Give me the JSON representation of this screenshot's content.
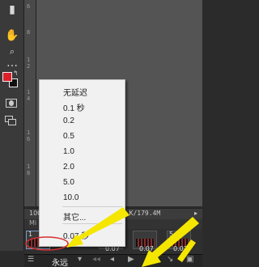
{
  "toolbar": {
    "tools": [
      {
        "icon": "hand-icon",
        "glyph": "✋"
      },
      {
        "icon": "zoom-icon",
        "glyph": "🔍"
      },
      {
        "icon": "ellipsis-icon",
        "glyph": "…"
      }
    ],
    "foreground_color": "#e01e2a",
    "background_color": "#111111"
  },
  "ruler": {
    "numbers": [
      "6",
      "8",
      "1",
      "2",
      "1",
      "4",
      "1",
      "6",
      "1",
      "8"
    ]
  },
  "statusbar": {
    "left": "100",
    "doc_size": "0 K/179.4M"
  },
  "panel": {
    "tab_label": "Mi"
  },
  "timeline": {
    "frames": [
      {
        "number": "1",
        "delay": ""
      },
      {
        "number": "4",
        "delay": "0.07"
      },
      {
        "number": "",
        "delay": "0.07"
      },
      {
        "number": "5",
        "delay": "0.07"
      }
    ],
    "loop_label": "永远"
  },
  "delay_menu": {
    "items": [
      "无延迟",
      "0.1 秒",
      "0.2",
      "0.5",
      "1.0",
      "2.0",
      "5.0",
      "10.0"
    ],
    "other_label": "其它...",
    "selected_label": "0.07 秒"
  },
  "annotation_color": "#f5e600"
}
